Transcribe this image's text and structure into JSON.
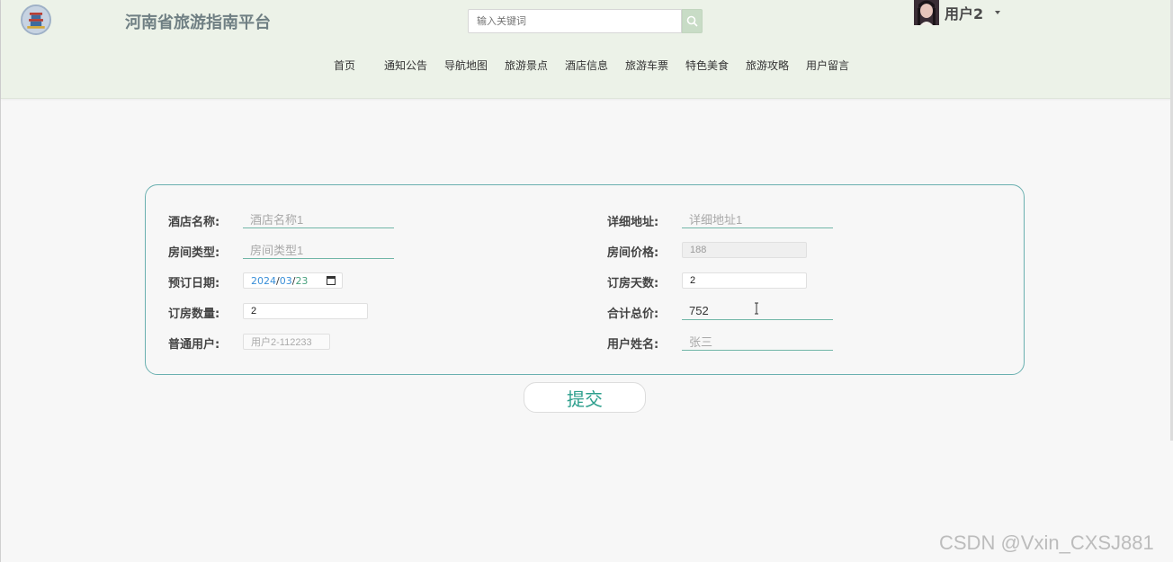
{
  "header": {
    "site_title": "河南省旅游指南平台",
    "search_placeholder": "输入关键词",
    "user_name": "用户2"
  },
  "nav": [
    {
      "label": "首页"
    },
    {
      "label": "通知公告"
    },
    {
      "label": "导航地图"
    },
    {
      "label": "旅游景点"
    },
    {
      "label": "酒店信息"
    },
    {
      "label": "旅游车票"
    },
    {
      "label": "特色美食"
    },
    {
      "label": "旅游攻略"
    },
    {
      "label": "用户留言"
    }
  ],
  "form": {
    "hotel_name_label": "酒店名称:",
    "hotel_name_value": "酒店名称1",
    "address_label": "详细地址:",
    "address_value": "详细地址1",
    "room_type_label": "房间类型:",
    "room_type_value": "房间类型1",
    "room_price_label": "房间价格:",
    "room_price_value": "188",
    "booking_date_label": "预订日期:",
    "booking_date_year": "2024",
    "booking_date_month": "03",
    "booking_date_day": "23",
    "booking_date_sep": "/",
    "days_label": "订房天数:",
    "days_value": "2",
    "quantity_label": "订房数量:",
    "quantity_value": "2",
    "total_label": "合计总价:",
    "total_value": "752",
    "user_label": "普通用户:",
    "user_value": "用户2-112233",
    "user_name_label": "用户姓名:",
    "user_name_value": "张三"
  },
  "submit_label": "提交",
  "watermark": "CSDN @Vxin_CXSJ881",
  "colors": {
    "header_bg": "#ecf2e8",
    "accent": "#2e9f8d",
    "card_border": "#6ab0b0"
  }
}
